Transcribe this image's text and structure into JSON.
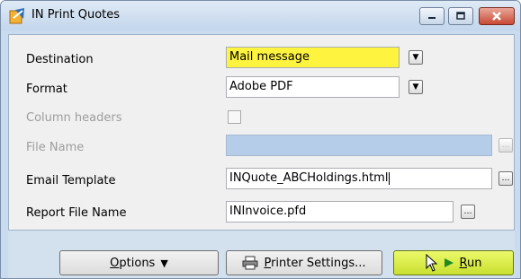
{
  "window": {
    "title": "IN Print Quotes",
    "controls": {
      "minimize": "minimize-icon",
      "maximize": "maximize-icon",
      "close": "close-icon"
    }
  },
  "form": {
    "destination": {
      "label": "Destination",
      "value": "Mail message"
    },
    "format": {
      "label": "Format",
      "value": "Adobe PDF"
    },
    "column_headers": {
      "label": "Column headers",
      "checked": false,
      "enabled": false
    },
    "file_name": {
      "label": "File Name",
      "value": "",
      "enabled": false
    },
    "email_template": {
      "label": "Email Template",
      "value": "INQuote_ABCHoldings.html"
    },
    "report_file_name": {
      "label": "Report File Name",
      "value": "INInvoice.pfd"
    }
  },
  "buttons": {
    "options": {
      "label_first": "O",
      "label_rest": "ptions"
    },
    "printer_settings": {
      "label_first": "P",
      "label_rest": "rinter Settings..."
    },
    "run": {
      "label_first": "R",
      "label_rest": "un"
    }
  },
  "colors": {
    "highlight_field": "#fef33f",
    "run_button": "#c9e030",
    "disabled_field": "#b5cde8"
  }
}
